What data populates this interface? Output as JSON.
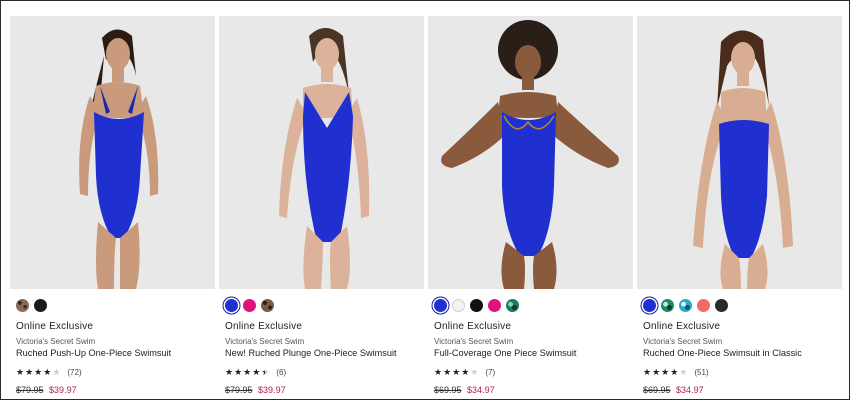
{
  "products": [
    {
      "badge": "Online Exclusive",
      "brand": "Victoria's Secret Swim",
      "name": "Ruched Push-Up One-Piece Swimsuit",
      "rating_stars": 4,
      "rating_count": "(72)",
      "price_was": "$79.95",
      "price_now": "$39.97",
      "swatches": [
        {
          "color": "#8a6b55",
          "pattern": "leopard",
          "selected": false
        },
        {
          "color": "#1a1a1a",
          "selected": false
        }
      ]
    },
    {
      "badge": "Online Exclusive",
      "brand": "Victoria's Secret Swim",
      "name": "New! Ruched Plunge One-Piece Swimsuit",
      "rating_stars": 4.5,
      "rating_count": "(6)",
      "price_was": "$79.95",
      "price_now": "$39.97",
      "swatches": [
        {
          "color": "#1f2fd0",
          "selected": true
        },
        {
          "color": "#e0127c",
          "selected": false
        },
        {
          "color": "#7a5a44",
          "pattern": "leopard",
          "selected": false
        }
      ]
    },
    {
      "badge": "Online Exclusive",
      "brand": "Victoria's Secret Swim",
      "name": "Full-Coverage One Piece Swimsuit",
      "rating_stars": 4,
      "rating_count": "(7)",
      "price_was": "$69.95",
      "price_now": "$34.97",
      "swatches": [
        {
          "color": "#1f2fd0",
          "selected": true
        },
        {
          "color": "#f4f4f4",
          "outline": true,
          "selected": false
        },
        {
          "color": "#111111",
          "selected": false
        },
        {
          "color": "#e0127c",
          "selected": false
        },
        {
          "color": "#1f7a62",
          "pattern": "tropical",
          "selected": false
        }
      ]
    },
    {
      "badge": "Online Exclusive",
      "brand": "Victoria's Secret Swim",
      "name": "Ruched One-Piece Swimsuit in Classic",
      "rating_stars": 4,
      "rating_count": "(51)",
      "price_was": "$69.95",
      "price_now": "$34.97",
      "swatches": [
        {
          "color": "#1f2fd0",
          "selected": true
        },
        {
          "color": "#1e8a6a",
          "pattern": "tropical",
          "selected": false
        },
        {
          "color": "#2aa7c9",
          "pattern": "tropical",
          "selected": false
        },
        {
          "color": "#f06a6a",
          "selected": false
        },
        {
          "color": "#2a2a2a",
          "selected": false
        }
      ]
    }
  ],
  "colors": {
    "sale_price": "#b0234a",
    "swimsuit_blue": "#1f2fd0",
    "photo_background": "#e9e9e9"
  },
  "icons": {
    "star": "star-icon"
  }
}
